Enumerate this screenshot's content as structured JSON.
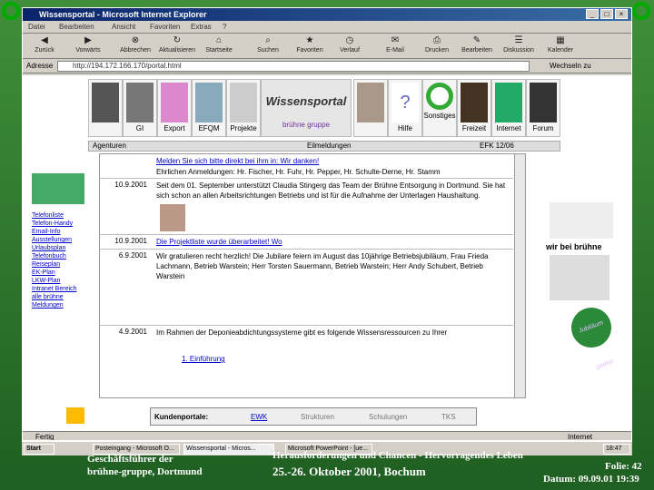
{
  "window": {
    "title": "Wissensportal - Microsoft Internet Explorer"
  },
  "address": {
    "label": "Adresse",
    "value": "http://194.172.166.170/portal.html",
    "go": "Wechseln zu"
  },
  "menu": [
    "Datei",
    "Bearbeiten",
    "Ansicht",
    "Favoriten",
    "Extras",
    "?"
  ],
  "toolbar": [
    "Zurück",
    "Vorwärts",
    "Abbrechen",
    "Aktualisieren",
    "Startseite",
    "Suchen",
    "Favoriten",
    "Verlauf",
    "E-Mail",
    "Drucken",
    "Bearbeiten",
    "Diskussion",
    "Kalender"
  ],
  "portals": [
    "GI",
    "Export",
    "EFQM",
    "Projekte",
    "brühne gruppe",
    "",
    "Hilfe",
    "Sonstiges",
    "Freizeit",
    "Internet",
    "Forum"
  ],
  "brand": "Wissensportal",
  "brand_sub": "brühne gruppe",
  "sub_bar": {
    "left": "Agenturen",
    "mid": "Eilmeldungen",
    "right": "EFK 12/06"
  },
  "news": [
    {
      "date": "",
      "text": "Melden Sie sich bitte direkt bei ihm in: Wir danken!",
      "link": true
    },
    {
      "date": "",
      "text": "Ehrlichen Anmeldungen: Hr. Fischer, Hr. Fuhr, Hr. Pepper, Hr. Schulte-Derne, Hr. Stamm",
      "link": false
    },
    {
      "date": "10.9.2001",
      "text": "Seit dem 01. September unterstützt Claudia Stingerg das Team der Brühne Entsorgung in Dortmund. Sie hat sich schon an allen Arbeitsrichtungen Betriebs und ist für die Aufnahme der Unterlagen Haushaltung.",
      "link": false
    },
    {
      "date": "10.9.2001",
      "text": "Die Projektliste wurde überarbeitet! Wo",
      "link": true
    },
    {
      "date": "6.9.2001",
      "text": "Wir gratulieren recht herzlich! Die Jubilare feiern im August das 10jährige Betriebsjubiläum, Frau Frieda Lachmann, Betrieb Warstein; Herr Torsten Sauermann, Betrieb Warstein; Herr Andy Schubert, Betrieb Warstein",
      "link": false
    },
    {
      "date": "4.9.2001",
      "text": "Im Rahmen der Deponieabdichtungssysteme gibt es folgende Wissensressourcen zu Ihrer",
      "link": false
    },
    {
      "date": "",
      "text": "1. Einführung",
      "link": true
    }
  ],
  "side_links": [
    "Telefonliste",
    "Telefon-Handy",
    "Email-Info",
    "Ausstellungen",
    "Urlaubsplan",
    "Telefonbuch",
    "Reiseplan",
    "EK-Plan",
    "LKW-Plan",
    "Intranet Bereich",
    "alle brühne Meldungen"
  ],
  "right": {
    "caption": "wir bei brühne",
    "badge": "Jubiläum geehrt"
  },
  "kunden": {
    "label": "Kundenportale:",
    "items": [
      "EWK",
      "Strukturen",
      "Schulungen",
      "TKS"
    ]
  },
  "status": "Fertig",
  "status_zone": "Internet",
  "taskbar": {
    "start": "Start",
    "tasks": [
      "Posteingang - Microsoft O...",
      "Wissensportal - Micros...",
      "Microsoft PowerPoint - [ue..."
    ],
    "clock": "18:47"
  },
  "footer": {
    "left_line1": "Geschäftsführer der",
    "left_line2": "brühne-gruppe, Dortmund",
    "mid_line1": "Herausforderungen und Chancen - Hervorragendes Leben",
    "mid_line2": "25.-26. Oktober 2001, Bochum",
    "slide": "Folie: 42",
    "date": "Datum: 09.09.01 19:39"
  },
  "colors": {
    "slide_green": "#2e7d32",
    "ie_title": "#0a246a",
    "link": "#0000cc",
    "accent_purple": "#7030a0"
  }
}
